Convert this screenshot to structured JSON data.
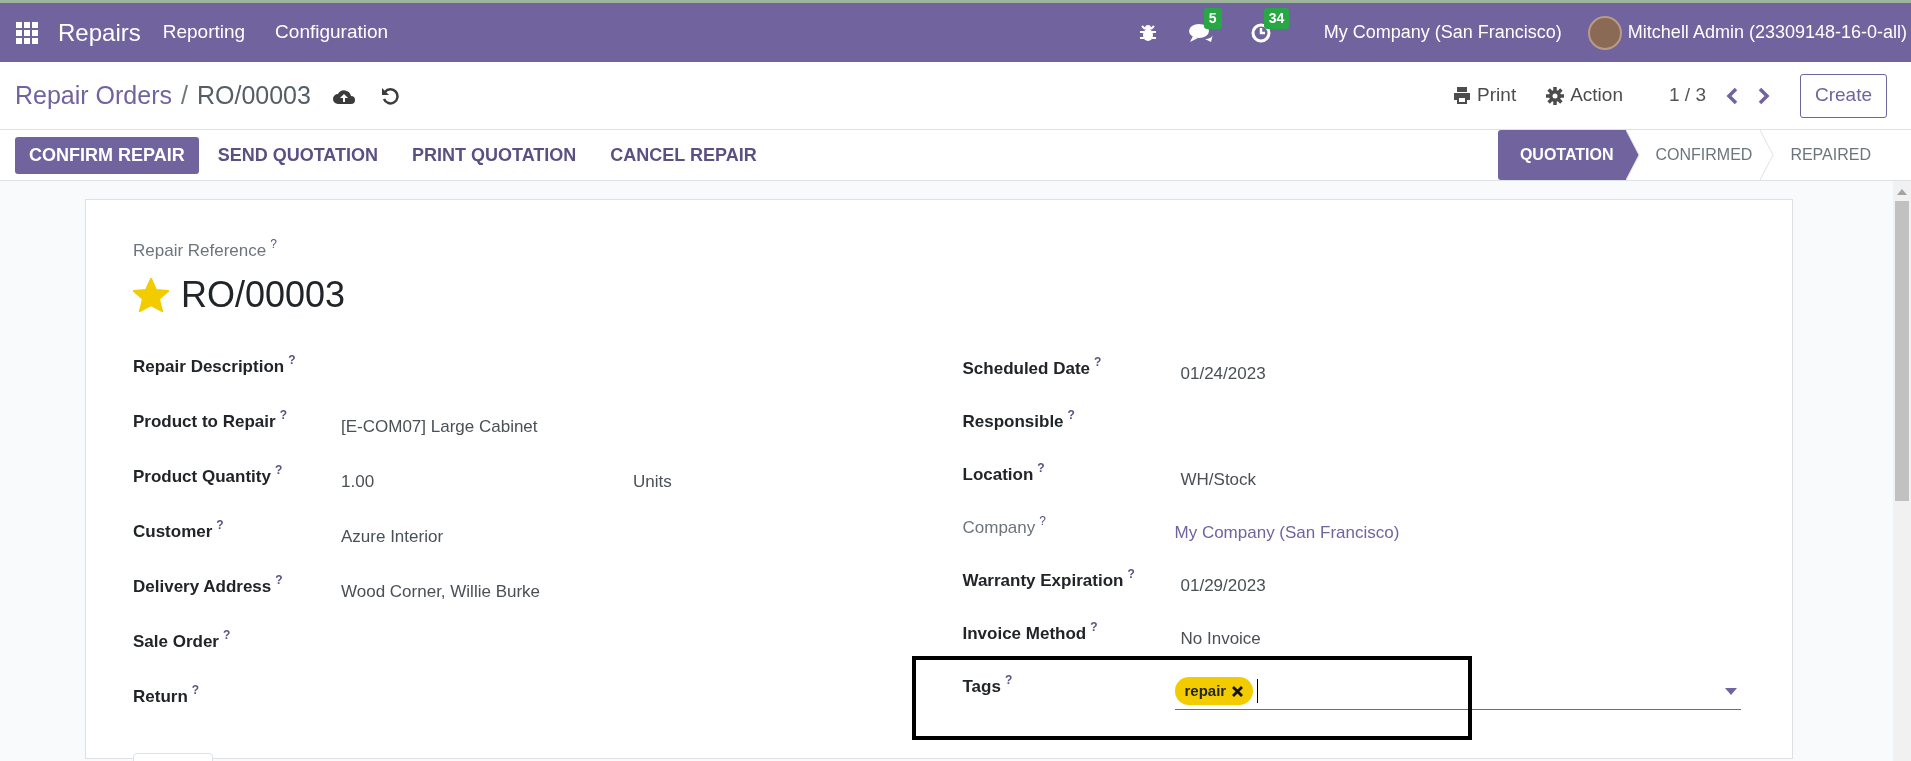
{
  "navbar": {
    "app": "Repairs",
    "menus": [
      "Reporting",
      "Configuration"
    ],
    "messages_count": "5",
    "activities_count": "34",
    "company": "My Company (San Francisco)",
    "user": "Mitchell Admin (23309148-16-0-all)"
  },
  "breadcrumb": {
    "parent": "Repair Orders",
    "separator": "/",
    "current": "RO/00003"
  },
  "control": {
    "print": "Print",
    "action": "Action",
    "pager": "1 / 3",
    "create": "Create"
  },
  "actions": [
    {
      "label": "CONFIRM REPAIR",
      "primary": true
    },
    {
      "label": "SEND QUOTATION",
      "primary": false
    },
    {
      "label": "PRINT QUOTATION",
      "primary": false
    },
    {
      "label": "CANCEL REPAIR",
      "primary": false
    }
  ],
  "stages": [
    {
      "label": "QUOTATION",
      "selected": true
    },
    {
      "label": "CONFIRMED",
      "selected": false
    },
    {
      "label": "REPAIRED",
      "selected": false
    }
  ],
  "form": {
    "reference_label": "Repair Reference",
    "help": "?",
    "starred": true,
    "reference": "RO/00003",
    "left_fields": [
      {
        "label": "Repair Description"
      },
      {
        "label": "Product to Repair",
        "value": "[E-COM07] Large Cabinet"
      },
      {
        "label": "Product Quantity",
        "value": "1.00",
        "unit": "Units"
      },
      {
        "label": "Customer",
        "value": "Azure Interior"
      },
      {
        "label": "Delivery Address",
        "value": "Wood Corner, Willie Burke"
      },
      {
        "label": "Sale Order"
      },
      {
        "label": "Return"
      }
    ],
    "right_fields": [
      {
        "kind": "text",
        "label": "Scheduled Date",
        "value": "01/24/2023",
        "readonly": false
      },
      {
        "kind": "text",
        "label": "Responsible",
        "readonly": false
      },
      {
        "kind": "text",
        "label": "Location",
        "value": "WH/Stock",
        "readonly": false
      },
      {
        "kind": "link",
        "label": "Company",
        "value": "My Company (San Francisco)",
        "readonly": true
      },
      {
        "kind": "text",
        "label": "Warranty Expiration",
        "value": "01/29/2023",
        "readonly": false
      },
      {
        "kind": "text",
        "label": "Invoice Method",
        "value": "No Invoice",
        "readonly": false
      },
      {
        "kind": "tags",
        "label": "Tags",
        "tags": [
          "repair"
        ],
        "readonly": false,
        "highlighted": true
      }
    ]
  }
}
